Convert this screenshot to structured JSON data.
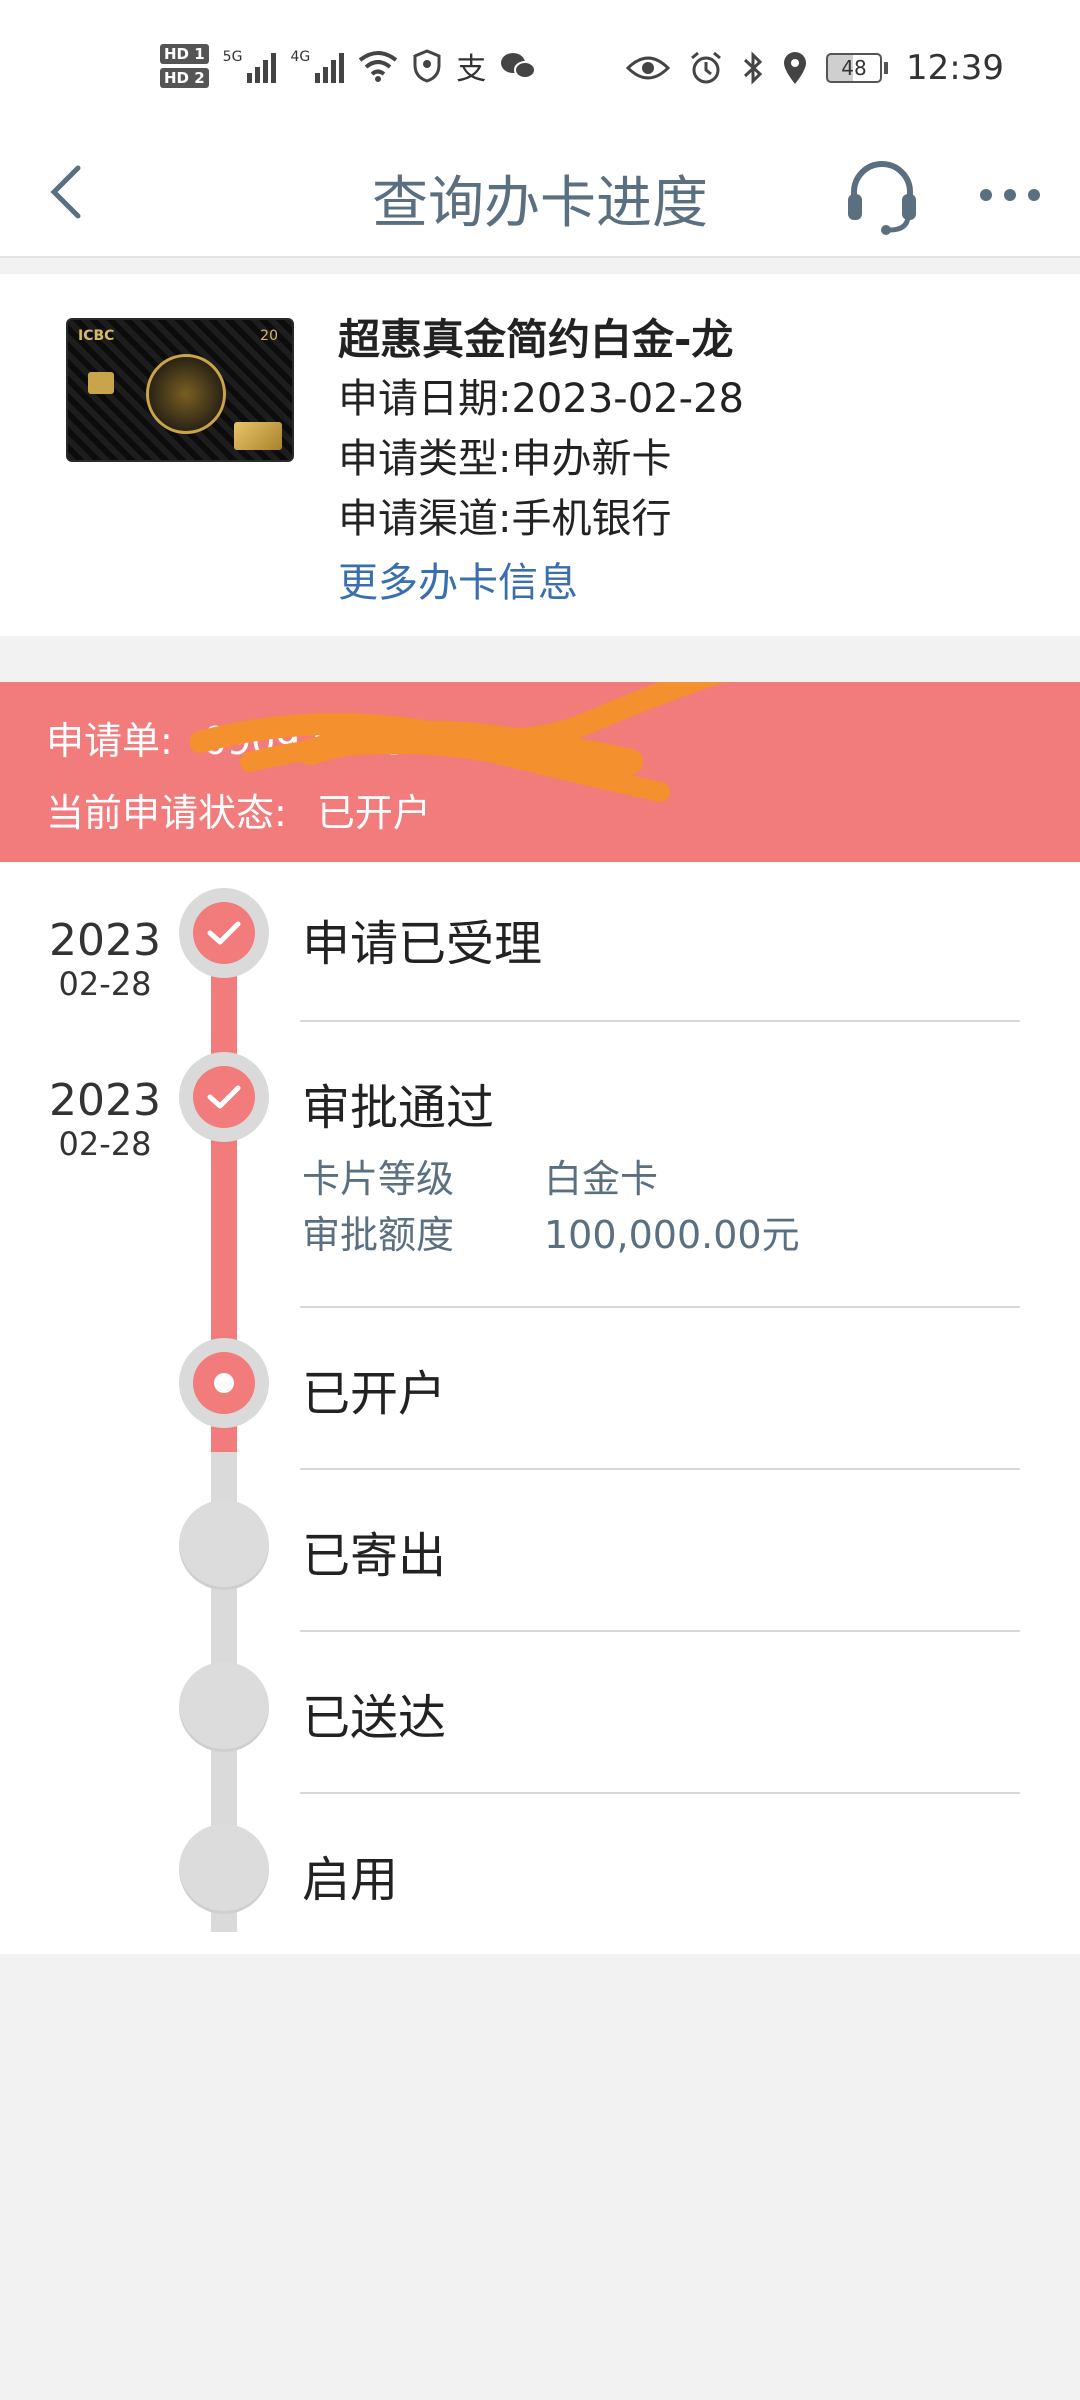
{
  "status_bar": {
    "hd1": "HD 1",
    "hd2": "HD 2",
    "net1": "5G",
    "net2": "4G",
    "battery": "48",
    "time": "12:39"
  },
  "header": {
    "title": "查询办卡进度"
  },
  "card": {
    "name": "超惠真金简约白金-龙",
    "apply_date_label": "申请日期:",
    "apply_date": "2023-02-28",
    "apply_type_label": "申请类型:",
    "apply_type": "申办新卡",
    "apply_channel_label": "申请渠道:",
    "apply_channel": "手机银行",
    "more_info": "更多办卡信息",
    "image_logo": "ICBC",
    "image_badge": "20"
  },
  "banner": {
    "order_label": "申请单:",
    "order_number": "0909202 5",
    "status_label": "当前申请状态:",
    "status": "已开户",
    "color": "#f27b7b"
  },
  "timeline": {
    "steps": [
      {
        "label": "申请已受理",
        "year": "2023",
        "date": "02-28",
        "state": "done"
      },
      {
        "label": "审批通过",
        "year": "2023",
        "date": "02-28",
        "state": "done"
      },
      {
        "label": "已开户",
        "state": "current"
      },
      {
        "label": "已寄出",
        "state": "pending"
      },
      {
        "label": "已送达",
        "state": "pending"
      },
      {
        "label": "启用",
        "state": "pending"
      }
    ],
    "approval_details": {
      "level_label": "卡片等级",
      "level_value": "白金卡",
      "limit_label": "审批额度",
      "limit_value": "100,000.00元"
    }
  },
  "icons": {
    "back": "chevron-left-icon",
    "service": "headset-icon",
    "more": "more-dots-icon",
    "check": "check-icon"
  }
}
